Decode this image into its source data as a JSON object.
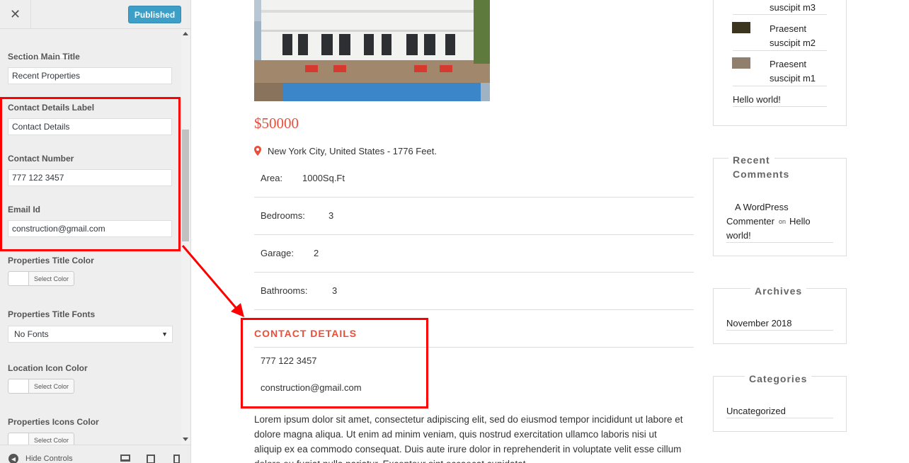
{
  "customizer": {
    "close_symbol": "✕",
    "publish_label": "Published",
    "section_main_title": {
      "label": "Section Main Title",
      "value": "Recent Properties"
    },
    "contact_details_label": {
      "label": "Contact Details Label",
      "value": "Contact Details"
    },
    "contact_number": {
      "label": "Contact Number",
      "value": "777 122 3457"
    },
    "email_id": {
      "label": "Email Id",
      "value": "construction@gmail.com"
    },
    "properties_title_color": {
      "label": "Properties Title Color",
      "button": "Select Color"
    },
    "properties_title_fonts": {
      "label": "Properties Title Fonts",
      "selected": "No Fonts"
    },
    "location_icon_color": {
      "label": "Location Icon Color",
      "button": "Select Color"
    },
    "properties_icons_color": {
      "label": "Properties Icons Color",
      "button": "Select Color"
    },
    "footer": {
      "hide_controls": "Hide Controls"
    }
  },
  "property": {
    "price": "$50000",
    "location": "New York City, United States - 1776 Feet.",
    "details": [
      {
        "key": "Area:",
        "value": "1000Sq.Ft"
      },
      {
        "key": "Bedrooms:",
        "value": "3"
      },
      {
        "key": "Garage:",
        "value": "2"
      },
      {
        "key": "Bathrooms:",
        "value": "3"
      }
    ],
    "contact_title": "CONTACT DETAILS",
    "contact_phone": "777 122 3457",
    "contact_email": "construction@gmail.com",
    "description": "Lorem ipsum dolor sit amet, consectetur adipiscing elit, sed do eiusmod tempor incididunt ut labore et dolore magna aliqua. Ut enim ad minim veniam, quis nostrud exercitation ullamco laboris nisi ut aliquip ex ea commodo consequat. Duis aute irure dolor in reprehenderit in voluptate velit esse cillum dolore eu fugiat nulla pariatur. Excepteur sint occaecat cupidatat"
  },
  "widgets": {
    "recent_posts": {
      "items": [
        {
          "line1": "suscipit m3",
          "line2": ""
        },
        {
          "line1": "Praesent",
          "line2": "suscipit m2"
        },
        {
          "line1": "Praesent",
          "line2": "suscipit m1"
        }
      ],
      "hello": "Hello world!"
    },
    "recent_comments": {
      "title_line1": "Recent",
      "title_line2": "Comments",
      "author": "A WordPress",
      "author2": "Commenter",
      "on": "on",
      "post": "Hello",
      "post2": "world!"
    },
    "archives": {
      "title": "Archives",
      "item": "November 2018"
    },
    "categories": {
      "title": "Categories",
      "item": "Uncategorized"
    }
  },
  "colors": {
    "accent_red": "#e94f3b",
    "annotation_red": "#ff0000",
    "publish_blue": "#0085ba"
  }
}
